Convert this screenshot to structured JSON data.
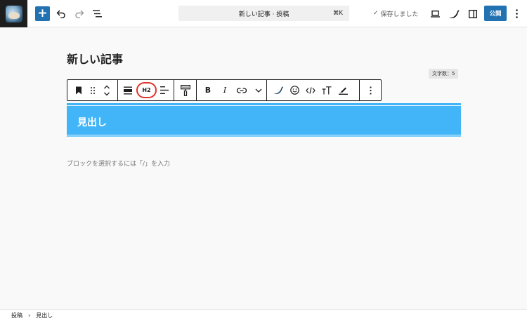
{
  "header": {
    "add_label": "+",
    "document_title": "新しい記事 · 投稿",
    "shortcut": "⌘K",
    "save_status": "保存しました",
    "publish_label": "公開"
  },
  "post": {
    "title": "新しい記事",
    "word_count": "文字数：5"
  },
  "block_toolbar": {
    "heading_level": "H2"
  },
  "heading_block": {
    "text": "見出し",
    "background": "#41b5f8"
  },
  "placeholder": "ブロックを選択するには「/」を入力",
  "breadcrumb": {
    "items": [
      "投稿",
      "見出し"
    ],
    "separator": "›"
  },
  "colors": {
    "accent": "#2271b1",
    "highlight": "#e0342c"
  }
}
